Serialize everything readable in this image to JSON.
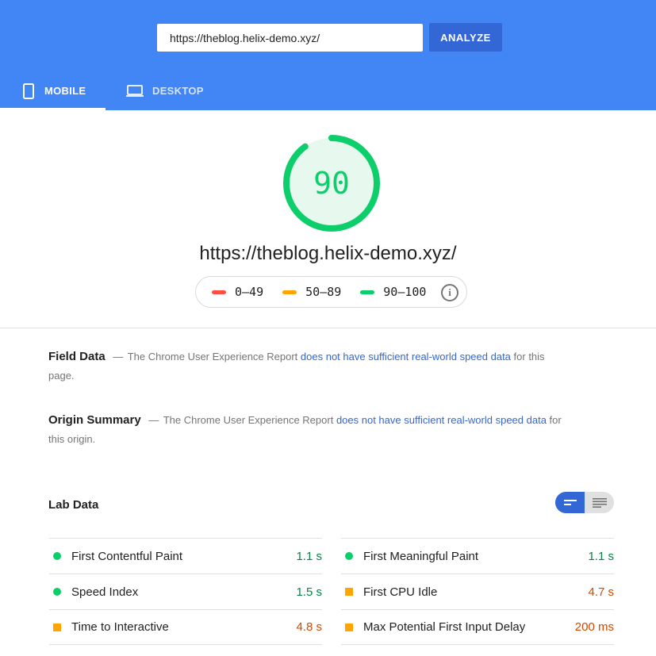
{
  "header": {
    "url_value": "https://theblog.helix-demo.xyz/",
    "analyze_label": "ANALYZE",
    "tabs": [
      {
        "label": "MOBILE",
        "icon": "mobile-icon",
        "active": true
      },
      {
        "label": "DESKTOP",
        "icon": "laptop-icon",
        "active": false
      }
    ]
  },
  "score": {
    "value": "90",
    "fraction": 0.9,
    "tested_url": "https://theblog.helix-demo.xyz/"
  },
  "legend": [
    {
      "range": "0–49",
      "color": "#ff4e42"
    },
    {
      "range": "50–89",
      "color": "#ffa400"
    },
    {
      "range": "90–100",
      "color": "#0cce6b"
    }
  ],
  "field_data": {
    "heading": "Field Data",
    "dash": "—",
    "text_before": "The Chrome User Experience Report",
    "link": "does not have sufficient real-world speed data",
    "text_after": "for this page."
  },
  "origin_summary": {
    "heading": "Origin Summary",
    "dash": "—",
    "text_before": "The Chrome User Experience Report",
    "link": "does not have sufficient real-world speed data",
    "text_after": "for this origin."
  },
  "lab_data": {
    "title": "Lab Data",
    "metrics_left": [
      {
        "label": "First Contentful Paint",
        "value": "1.1 s",
        "status": "pass"
      },
      {
        "label": "Speed Index",
        "value": "1.5 s",
        "status": "pass"
      },
      {
        "label": "Time to Interactive",
        "value": "4.8 s",
        "status": "average"
      }
    ],
    "metrics_right": [
      {
        "label": "First Meaningful Paint",
        "value": "1.1 s",
        "status": "pass"
      },
      {
        "label": "First CPU Idle",
        "value": "4.7 s",
        "status": "average"
      },
      {
        "label": "Max Potential First Input Delay",
        "value": "200 ms",
        "status": "average"
      }
    ]
  },
  "colors": {
    "header_bg": "#4285f4",
    "accent": "#3367d6",
    "pass": "#0cce6b",
    "average": "#ffa400",
    "fail": "#ff4e42"
  }
}
